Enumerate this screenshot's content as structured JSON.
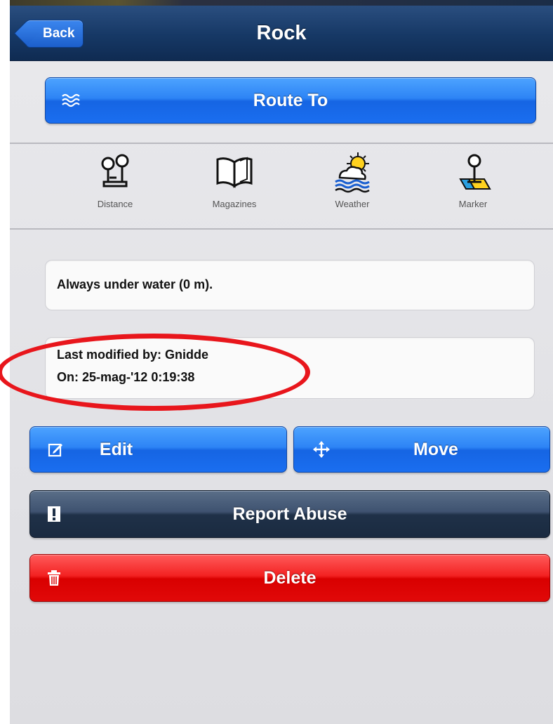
{
  "nav": {
    "back_label": "Back",
    "title": "Rock"
  },
  "route": {
    "label": "Route To",
    "icon": "waves-icon"
  },
  "tools": [
    {
      "label": "Distance",
      "icon": "distance-icon"
    },
    {
      "label": "Magazines",
      "icon": "book-icon"
    },
    {
      "label": "Weather",
      "icon": "weather-icon"
    },
    {
      "label": "Marker",
      "icon": "marker-pin-icon"
    }
  ],
  "description": "Always under water (0 m).",
  "modified": {
    "by": "Last modified by: Gnidde",
    "on": "On: 25-mag-'12 0:19:38"
  },
  "actions": {
    "edit_label": "Edit",
    "move_label": "Move",
    "report_label": "Report Abuse",
    "delete_label": "Delete"
  },
  "colors": {
    "navbar": "#163865",
    "primary_button": "#2d84f5",
    "dark_button": "#2b3c55",
    "danger_button": "#e10909",
    "highlight": "#e8161c"
  }
}
